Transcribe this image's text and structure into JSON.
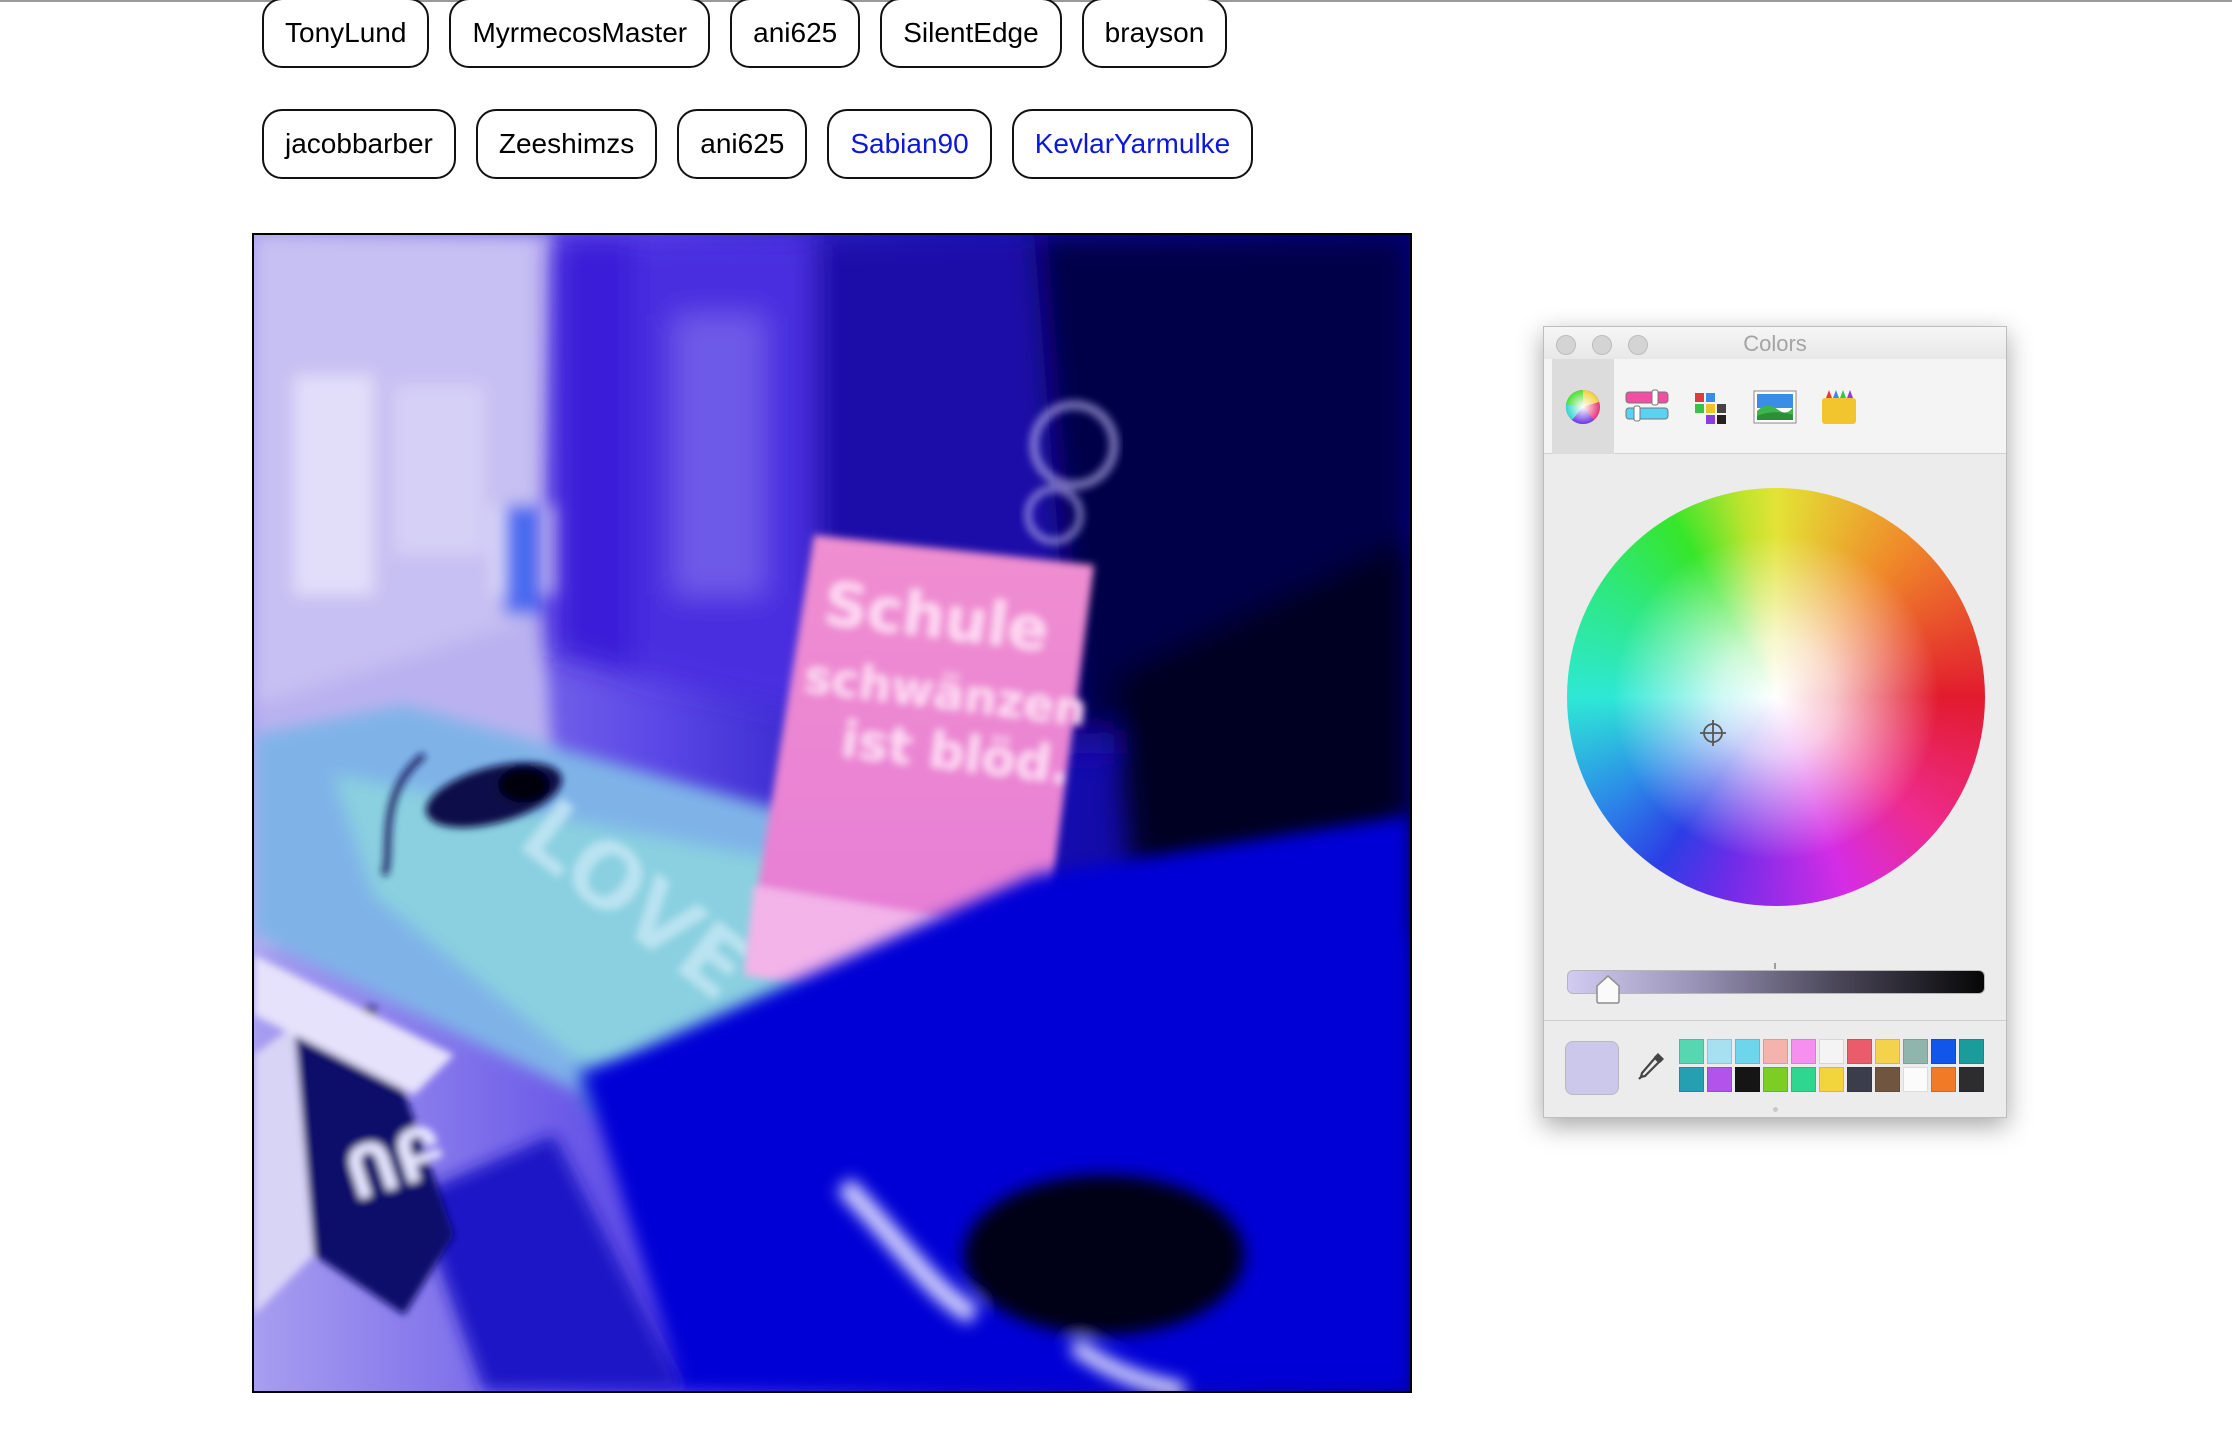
{
  "users": {
    "row1": [
      {
        "label": "TonyLund",
        "visited": false
      },
      {
        "label": "MyrmecosMaster",
        "visited": false
      },
      {
        "label": "ani625",
        "visited": false
      },
      {
        "label": "SilentEdge",
        "visited": false
      },
      {
        "label": "brayson",
        "visited": false
      }
    ],
    "row2": [
      {
        "label": "jacobbarber",
        "visited": false
      },
      {
        "label": "Zeeshimzs",
        "visited": false
      },
      {
        "label": "ani625",
        "visited": false
      },
      {
        "label": "Sabian90",
        "visited": true
      },
      {
        "label": "KevlarYarmulke",
        "visited": true
      }
    ]
  },
  "canvas": {
    "sign_lines": [
      "Schule",
      "schwänzen",
      "ist blöd."
    ],
    "desk_text": "LOVE"
  },
  "colors_panel": {
    "title": "Colors",
    "tabs": [
      {
        "name": "color-wheel-tab",
        "selected": true
      },
      {
        "name": "color-sliders-tab",
        "selected": false
      },
      {
        "name": "color-palettes-tab",
        "selected": false
      },
      {
        "name": "image-palettes-tab",
        "selected": false
      },
      {
        "name": "pencils-tab",
        "selected": false
      }
    ],
    "brightness": 0.08,
    "current_color": "#ccc8ec",
    "swatches": [
      "#56d6b1",
      "#a7e1f1",
      "#6dd6ec",
      "#f5b3ad",
      "#f68ff0",
      "#f4f4f4",
      "#ea5c69",
      "#f5d24c",
      "#8fb5ad",
      "#1156ea",
      "#1a9c9c",
      "#24a0b2",
      "#b453ec",
      "#151515",
      "#7ccd24",
      "#2fd68f",
      "#f2d53c",
      "#3b3d4c",
      "#705640",
      "#fbfbfb",
      "#f07a25",
      "#2d2d2f"
    ]
  },
  "colors": {
    "visited_link": "#0b18d8",
    "canvas_blue": "#0000d8"
  }
}
